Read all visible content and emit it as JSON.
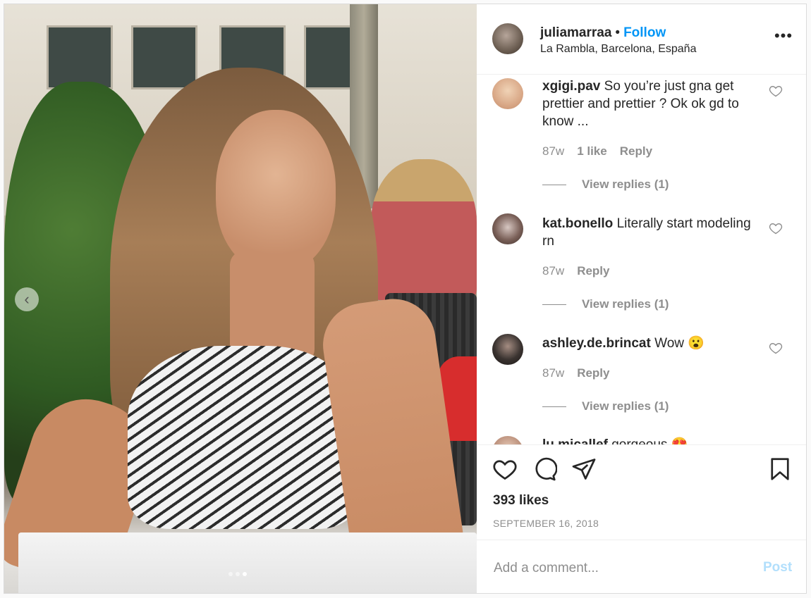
{
  "post": {
    "username": "juliamarraa",
    "separator": "•",
    "follow_label": "Follow",
    "location": "La Rambla, Barcelona, España",
    "more_label": "•••",
    "carousel": {
      "total": 3,
      "active": 3
    }
  },
  "comments": [
    {
      "username": "xgigi.pav",
      "text": "So you’re just gna get prettier and prettier ? Ok ok gd to know ...",
      "age": "87w",
      "likes": "1 like",
      "reply_label": "Reply",
      "view_replies": "View replies (1)",
      "avatar_color": "#e9c7a6"
    },
    {
      "username": "kat.bonello",
      "text": "Literally start modeling rn",
      "age": "87w",
      "likes": "",
      "reply_label": "Reply",
      "view_replies": "View replies (1)",
      "avatar_color": "#7a6058"
    },
    {
      "username": "ashley.de.brincat",
      "text": "Wow 😮",
      "age": "87w",
      "likes": "",
      "reply_label": "Reply",
      "view_replies": "View replies (1)",
      "avatar_color": "#3a3330"
    },
    {
      "username": "lu.micallef",
      "text": "gorgeous 😍",
      "age": "",
      "likes": "",
      "reply_label": "",
      "view_replies": "",
      "avatar_color": "#b98d78"
    }
  ],
  "actions": {
    "likes": "393 likes",
    "date": "SEPTEMBER 16, 2018"
  },
  "add_comment": {
    "placeholder": "Add a comment...",
    "post_label": "Post"
  },
  "colors": {
    "accent": "#0095f6",
    "muted": "#8e8e8e",
    "text": "#262626",
    "post_disabled": "#b2dffc"
  }
}
